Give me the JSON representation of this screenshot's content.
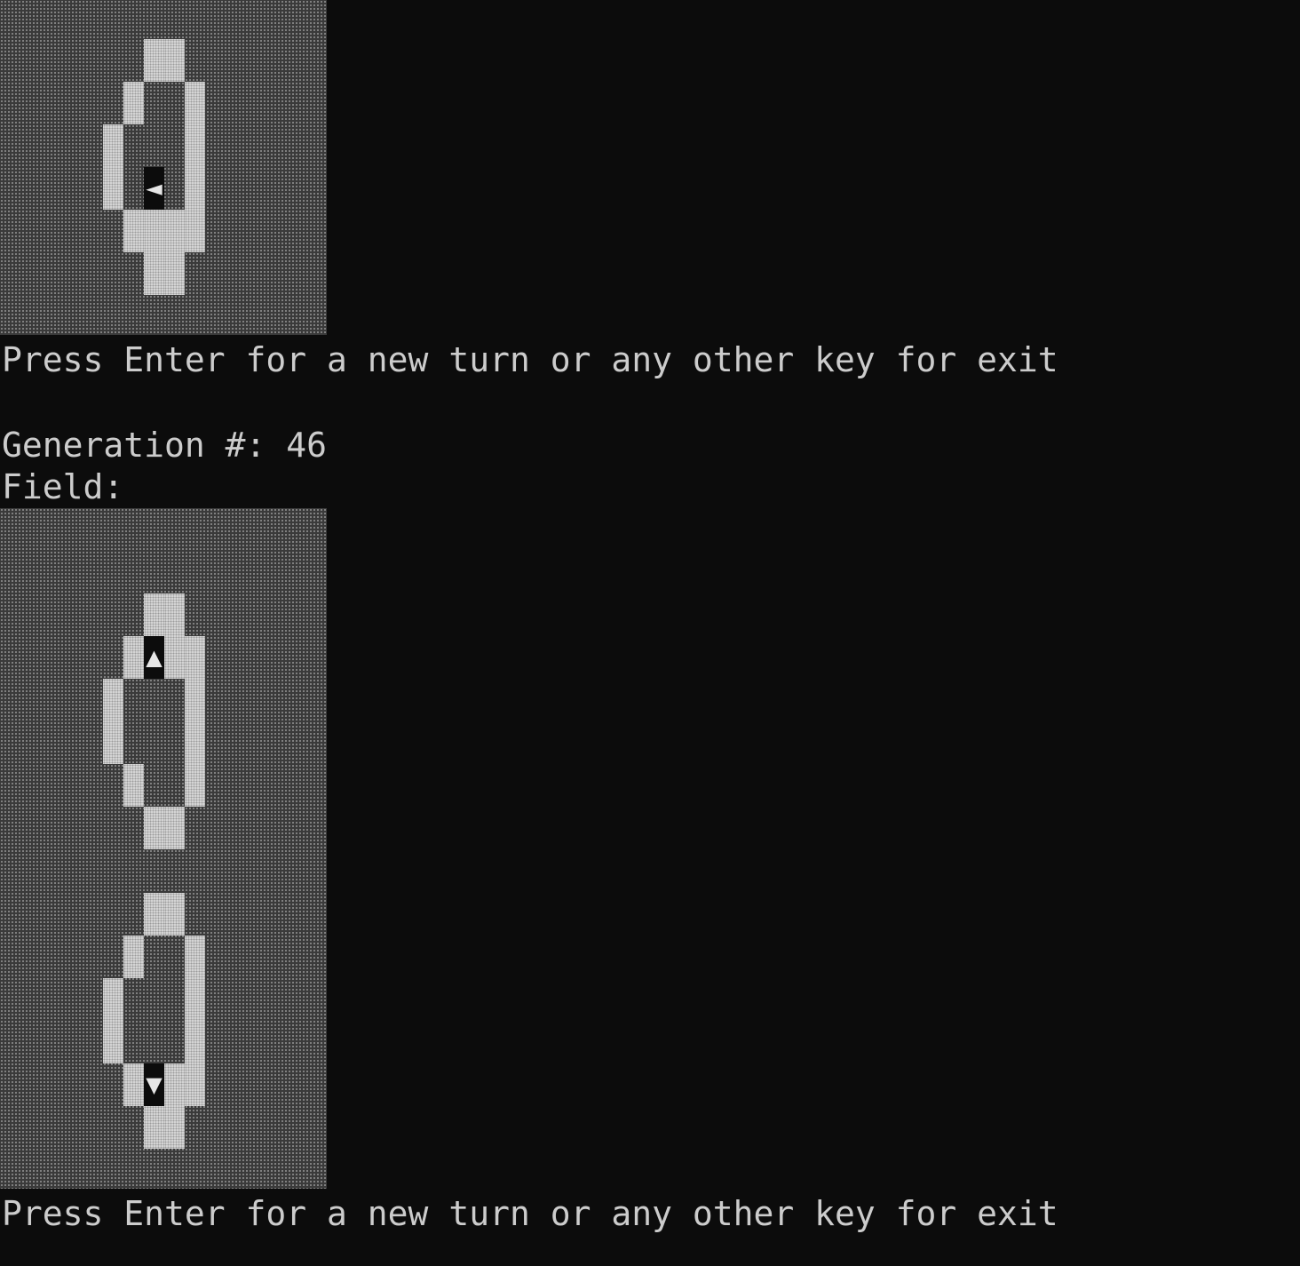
{
  "terminal": {
    "prompt_1": "Press Enter for a new turn or any other key for exit",
    "generation_label": "Generation #: 46",
    "field_label": "Field:",
    "prompt_2": "Press Enter for a new turn or any other key for exit"
  },
  "ants": {
    "top_field": {
      "direction": "left",
      "glyph": "◄"
    },
    "bottom_field_upper": {
      "direction": "up",
      "glyph": "▲"
    },
    "bottom_field_lower": {
      "direction": "down",
      "glyph": "▼"
    }
  },
  "colors": {
    "background": "#0c0c0c",
    "text": "#cccccc",
    "live_cell": "#d6d6d6",
    "dead_cell": "#3a3a3a"
  }
}
